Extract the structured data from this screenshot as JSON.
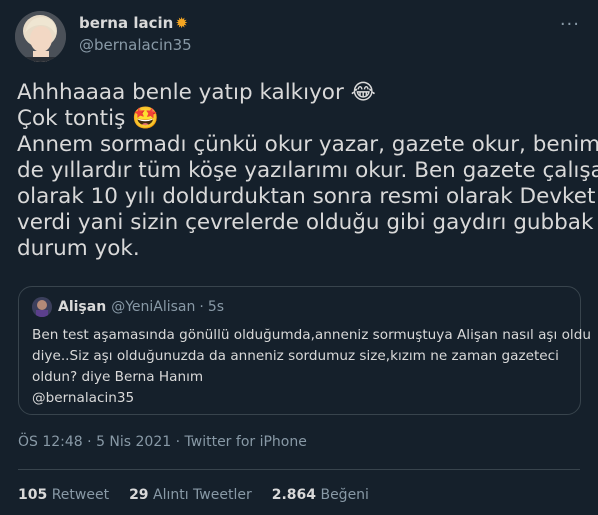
{
  "author": {
    "display_name": "berna lacin",
    "handle": "@bernalacin35"
  },
  "more_icon": "ellipsis-icon",
  "tweet": {
    "lines": [
      "Ahhhaaaa benle yatıp kalkıyor",
      "Çok tontiş",
      "Annem sormadı çünkü okur yazar, gazete okur, benim",
      "de yıllardır tüm köşe yazılarımı okur. Ben gazete çalışanı",
      "olarak 10 yılı doldurduktan sonra resmi olarak Devket",
      "verdi yani sizin çevrelerde olduğu gibi gaydırı gubbak",
      "durum yok."
    ]
  },
  "quote": {
    "name": "Alişan",
    "handle": "@YeniAlisan",
    "separator": "·",
    "time": "5s",
    "lines": [
      "Ben test aşamasında gönüllü olduğumda,anneniz sormuştuya Alişan nasıl aşı oldu",
      "diye..Siz aşı olduğunuzda da anneniz sordumuz size,kızım ne zaman gazeteci",
      "oldun? diye Berna Hanım",
      "@bernalacin35"
    ]
  },
  "meta": {
    "time": "ÖS 12:48",
    "sep1": "·",
    "date": "5 Nis 2021",
    "sep2": "·",
    "source": "Twitter for iPhone"
  },
  "stats": {
    "retweets": {
      "count": "105",
      "label": "Retweet"
    },
    "quotes": {
      "count": "29",
      "label": "Alıntı Tweetler"
    },
    "likes": {
      "count": "2.864",
      "label": "Beğeni"
    }
  },
  "colors": {
    "background": "#15202b",
    "text": "#d9d9d9",
    "muted": "#8899a6",
    "border": "#38444d"
  }
}
